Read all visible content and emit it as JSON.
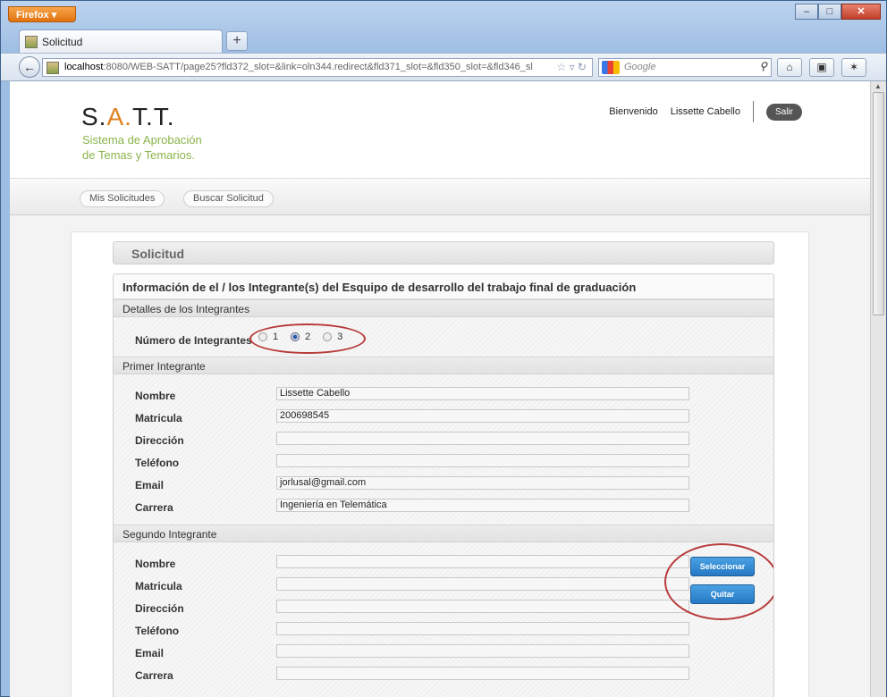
{
  "browser": {
    "menu_label": "Firefox ▾",
    "tab_title": "Solicitud",
    "url_host": "localhost",
    "url_rest": ":8080/WEB-SATT/page25?fld372_slot=&link=oln344.redirect&fld371_slot=&fld350_slot=&fld346_sl",
    "search_placeholder": "Google"
  },
  "header": {
    "logo_s": "S.",
    "logo_a": "A.",
    "logo_rest": "T.T.",
    "tagline_1": "Sistema de Aprobación",
    "tagline_2": "de Temas y Temarios.",
    "welcome": "Bienvenido",
    "user_name": "Lissette Cabello",
    "logout": "Salir"
  },
  "nav": {
    "items": [
      {
        "label": "Mis Solicitudes"
      },
      {
        "label": "Buscar Solicitud"
      }
    ]
  },
  "main": {
    "title": "Solicitud",
    "panel_title": "Información de el / los Integrante(s) del Esquipo de desarrollo del trabajo final de graduación",
    "details_header": "Detalles de los Integrantes",
    "num_label": "Número de Integrantes",
    "options": [
      "1",
      "2",
      "3"
    ],
    "selected_option": "2",
    "first_header": "Primer Integrante",
    "second_header": "Segundo Integrante",
    "field_labels": [
      "Nombre",
      "Matricula",
      "Dirección",
      "Teléfono",
      "Email",
      "Carrera"
    ],
    "first": {
      "nombre": "Lissette Cabello",
      "matricula": "200698545",
      "direccion": "",
      "telefono": "",
      "email": "jorlusal@gmail.com",
      "carrera": "Ingeniería en Telemática"
    },
    "second": {
      "nombre": "",
      "matricula": "",
      "direccion": "",
      "telefono": "",
      "email": "",
      "carrera": ""
    },
    "select_button": "Seleccionar",
    "remove_button": "Quitar"
  }
}
